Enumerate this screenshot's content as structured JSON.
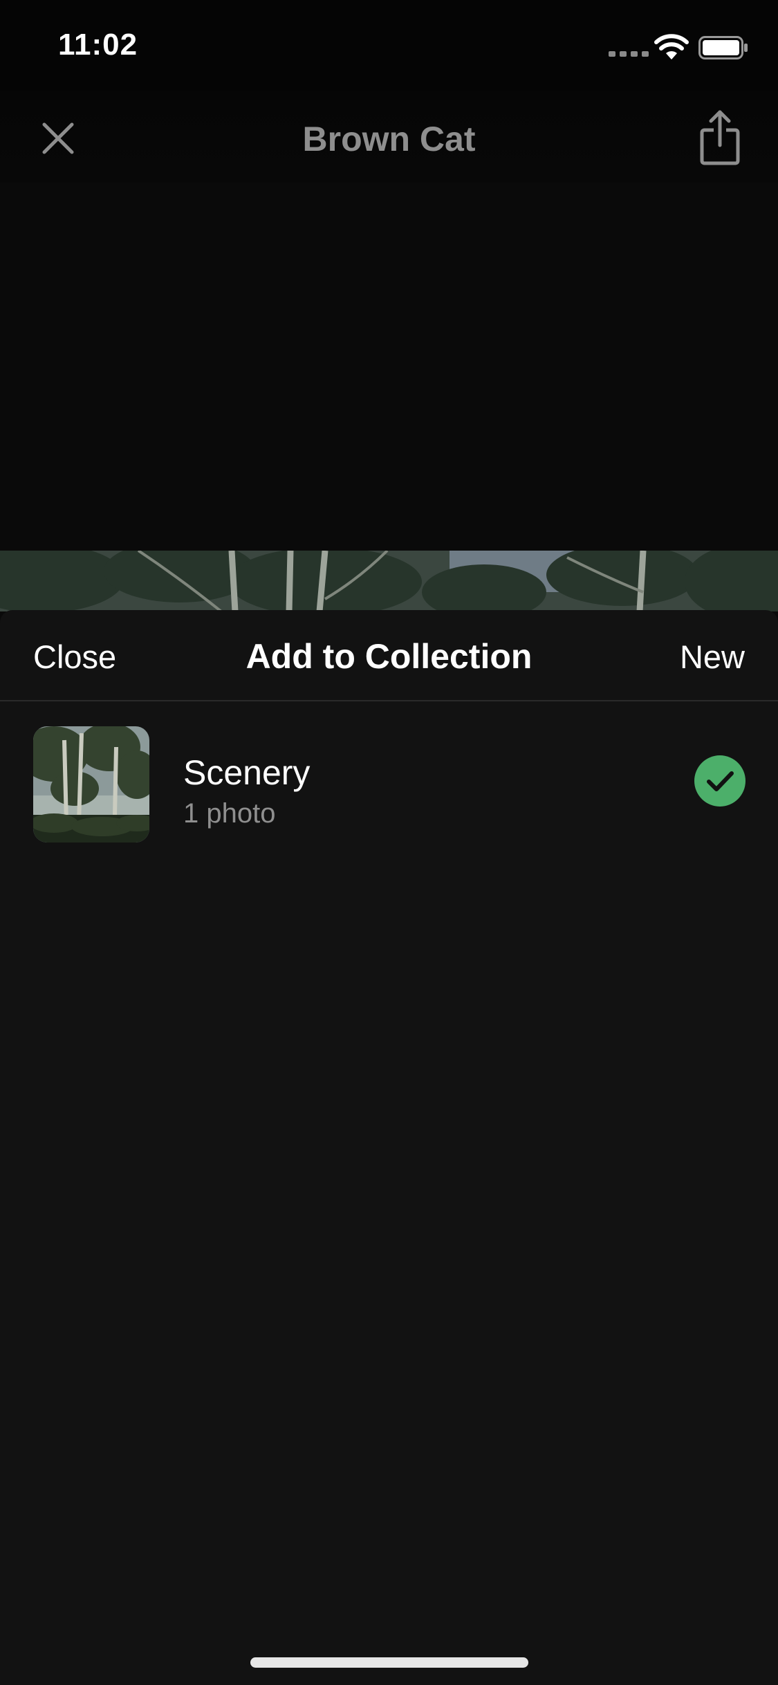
{
  "status_bar": {
    "time": "11:02",
    "icons": [
      "cellular-signal-icon",
      "wifi-icon",
      "battery-icon"
    ]
  },
  "top_nav": {
    "title": "Brown Cat",
    "close_icon": "close-icon",
    "share_icon": "share-icon"
  },
  "sheet": {
    "title": "Add to Collection",
    "close_label": "Close",
    "new_label": "New",
    "collections": [
      {
        "name": "Scenery",
        "count": "1 photo",
        "selected": true,
        "check_icon": "checkmark-circle-icon"
      }
    ]
  },
  "colors": {
    "background": "#0a0a0a",
    "sheet": "#121212",
    "selected": "#4caf6a",
    "secondary_text": "#8f8f8f"
  }
}
